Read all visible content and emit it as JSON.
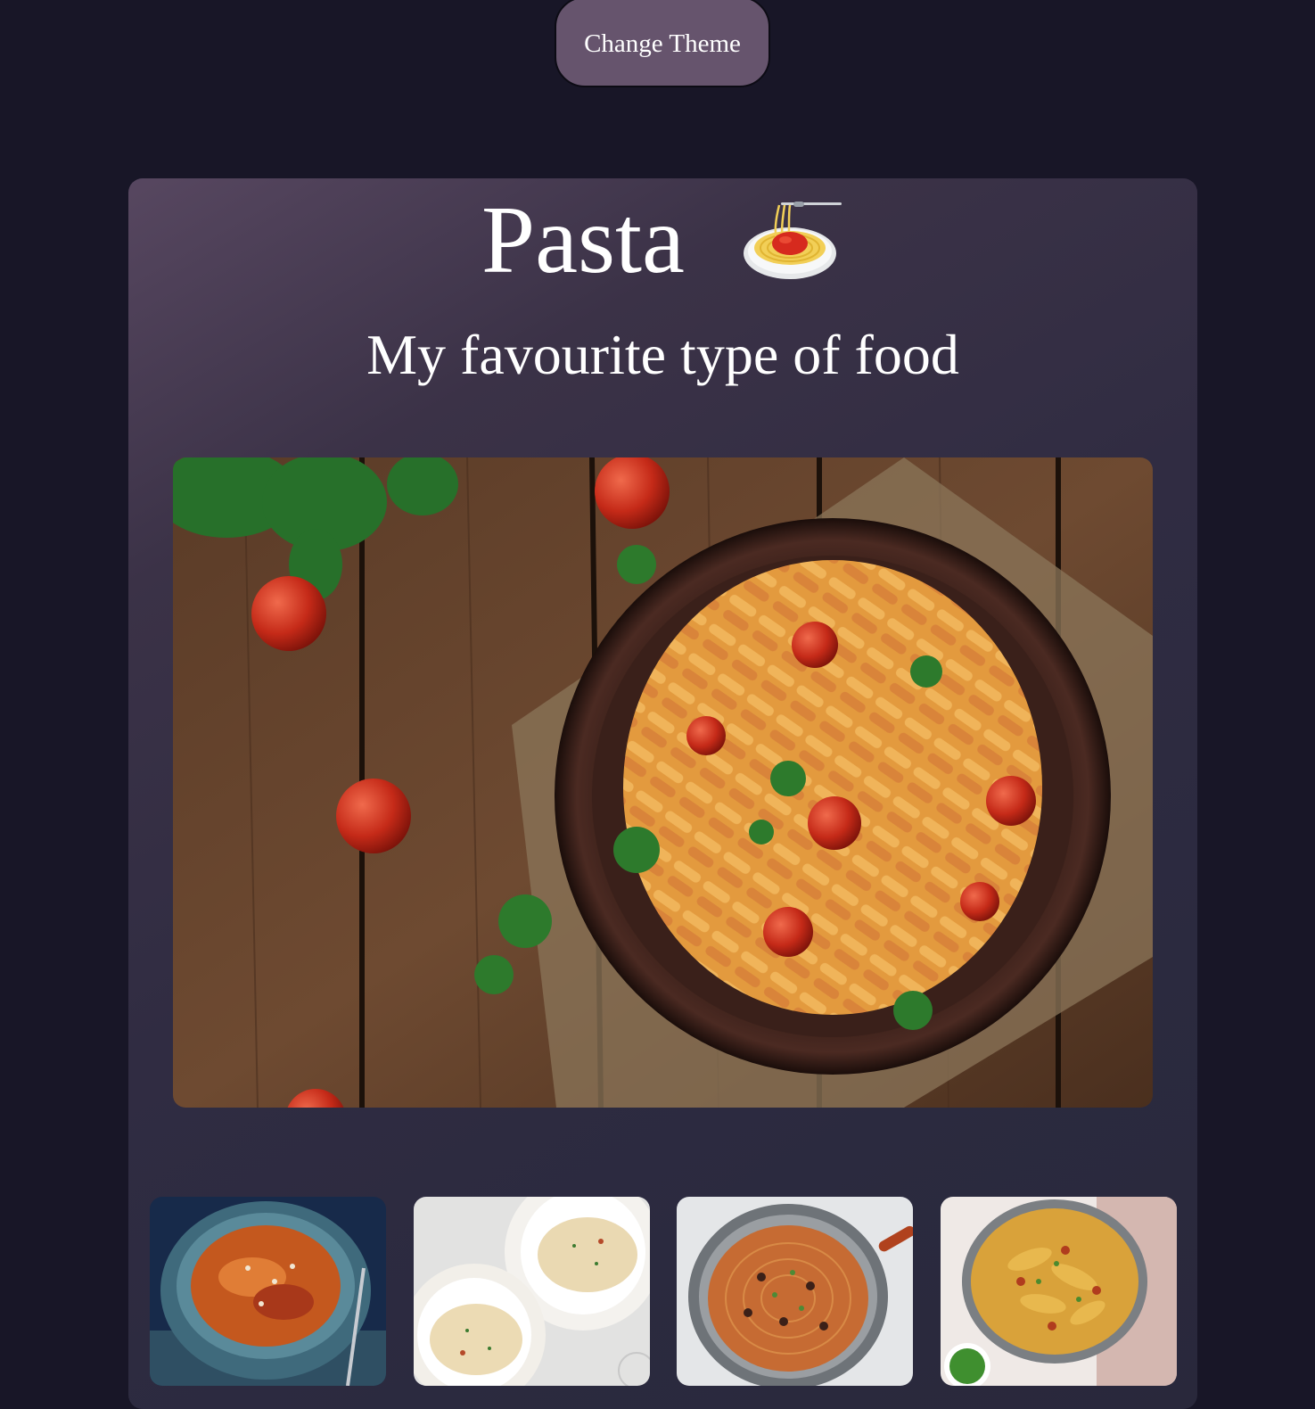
{
  "header": {
    "theme_button_label": "Change Theme"
  },
  "card": {
    "title": "Pasta",
    "title_icon": "spaghetti-icon",
    "subtitle": "My favourite type of food"
  },
  "images": {
    "hero": "penne-with-tomato-photo",
    "thumbnails": [
      "penne-bowl-photo",
      "tagliatelle-plates-photo",
      "spaghetti-pan-photo",
      "pappardelle-pan-photo"
    ]
  },
  "colors": {
    "page_background": "#181627",
    "button_background": "#66546d",
    "card_gradient_start": "#574760",
    "card_gradient_end": "#29283b",
    "text": "#ffffff"
  }
}
